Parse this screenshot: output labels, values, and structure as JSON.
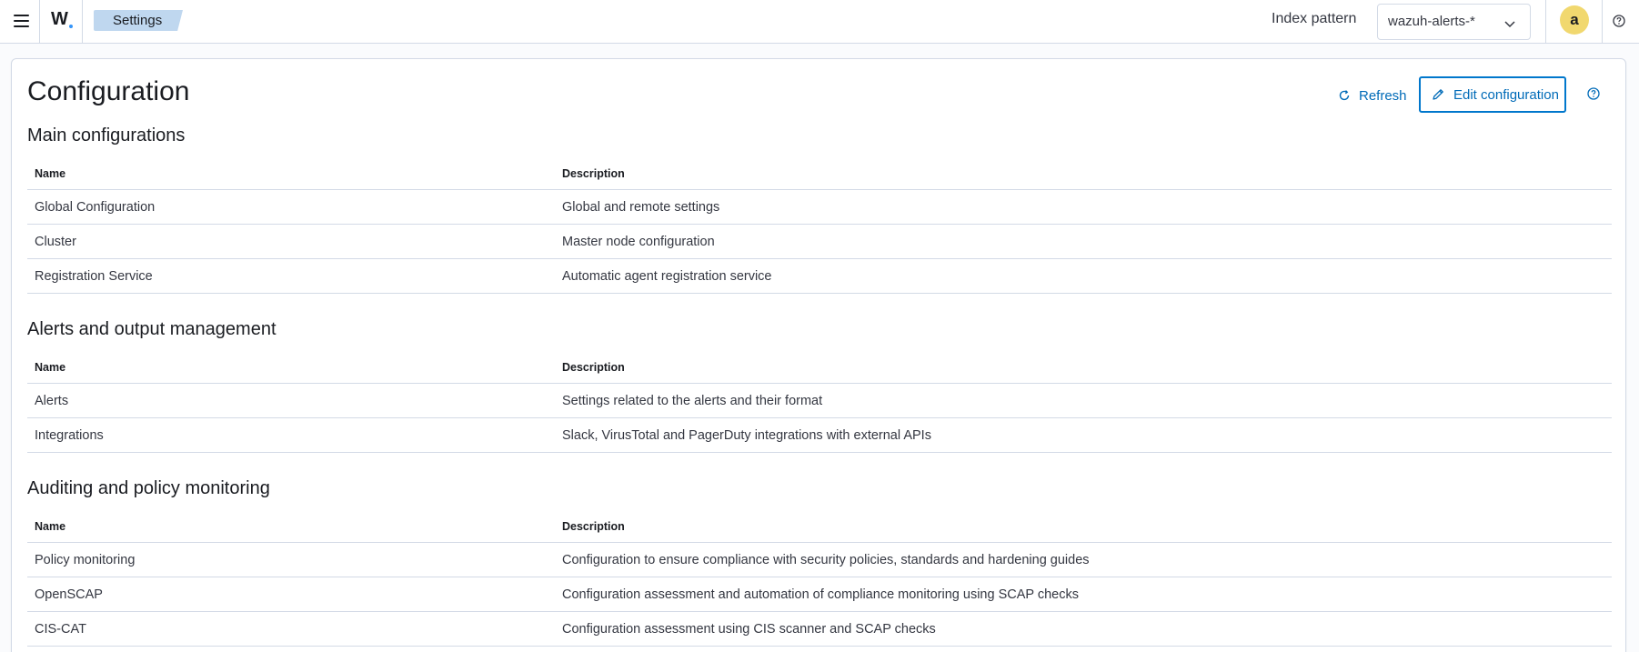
{
  "header": {
    "logo": "W",
    "breadcrumb": "Settings",
    "index_pattern_label": "Index pattern",
    "index_pattern_value": "wazuh-alerts-*",
    "avatar_initial": "a"
  },
  "page": {
    "title": "Configuration",
    "refresh_label": "Refresh",
    "edit_label": "Edit configuration"
  },
  "columns": {
    "name": "Name",
    "description": "Description"
  },
  "sections": [
    {
      "title": "Main configurations",
      "rows": [
        {
          "name": "Global Configuration",
          "description": "Global and remote settings"
        },
        {
          "name": "Cluster",
          "description": "Master node configuration"
        },
        {
          "name": "Registration Service",
          "description": "Automatic agent registration service"
        }
      ]
    },
    {
      "title": "Alerts and output management",
      "rows": [
        {
          "name": "Alerts",
          "description": "Settings related to the alerts and their format"
        },
        {
          "name": "Integrations",
          "description": "Slack, VirusTotal and PagerDuty integrations with external APIs"
        }
      ]
    },
    {
      "title": "Auditing and policy monitoring",
      "rows": [
        {
          "name": "Policy monitoring",
          "description": "Configuration to ensure compliance with security policies, standards and hardening guides"
        },
        {
          "name": "OpenSCAP",
          "description": "Configuration assessment and automation of compliance monitoring using SCAP checks"
        },
        {
          "name": "CIS-CAT",
          "description": "Configuration assessment using CIS scanner and SCAP checks"
        }
      ]
    }
  ],
  "colors": {
    "accent": "#006bb8",
    "breadcrumb_bg": "#bfd7ef",
    "avatar_bg": "#f1d86f",
    "border": "#d3dae6"
  },
  "icons": [
    "menu-icon",
    "refresh-icon",
    "pencil-icon",
    "help-icon",
    "chevron-down-icon"
  ]
}
